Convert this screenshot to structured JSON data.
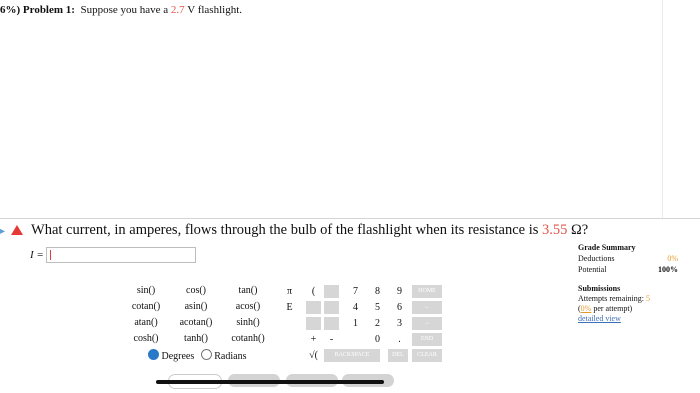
{
  "problem": {
    "prefix": "6%) Problem 1:",
    "text_before": "Suppose you have a",
    "value": "2.7",
    "text_after": "V flashlight."
  },
  "question": {
    "text_before": "What current, in amperes, flows through the bulb of the flashlight when its resistance is",
    "value": "3.55",
    "unit": "Ω?"
  },
  "answer": {
    "label": "I =",
    "value": ""
  },
  "calculator": {
    "functions": [
      [
        "sin()",
        "cos()",
        "tan()"
      ],
      [
        "cotan()",
        "asin()",
        "acos()"
      ],
      [
        "atan()",
        "acotan()",
        "sinh()"
      ],
      [
        "cosh()",
        "tanh()",
        "cotanh()"
      ]
    ],
    "constants": [
      "π",
      "E"
    ],
    "operators": [
      "(",
      "+",
      "-",
      "√("
    ],
    "keypad": [
      [
        "7",
        "8",
        "9",
        "HOME"
      ],
      [
        "4",
        "5",
        "6",
        "←"
      ],
      [
        "1",
        "2",
        "3",
        "→"
      ],
      [
        "0",
        ".",
        "END"
      ]
    ],
    "backspace": "BACKSPACE",
    "del": "DEL",
    "clear": "CLEAR",
    "mode": {
      "degrees": "Degrees",
      "radians": "Radians",
      "selected": "Degrees"
    }
  },
  "grade_summary": {
    "title": "Grade Summary",
    "deductions_label": "Deductions",
    "deductions_value": "0%",
    "potential_label": "Potential",
    "potential_value": "100%"
  },
  "submissions": {
    "title": "Submissions",
    "attempts_label": "Attempts remaining:",
    "attempts_value": "5",
    "per_attempt_value": "0%",
    "per_attempt_label": "per attempt)",
    "detailed_view": "detailed view"
  },
  "colors": {
    "accent_red": "#e2574c",
    "link_blue": "#3b6fb6",
    "radio_blue": "#2979c9",
    "key_gray": "#d6d6d6"
  }
}
